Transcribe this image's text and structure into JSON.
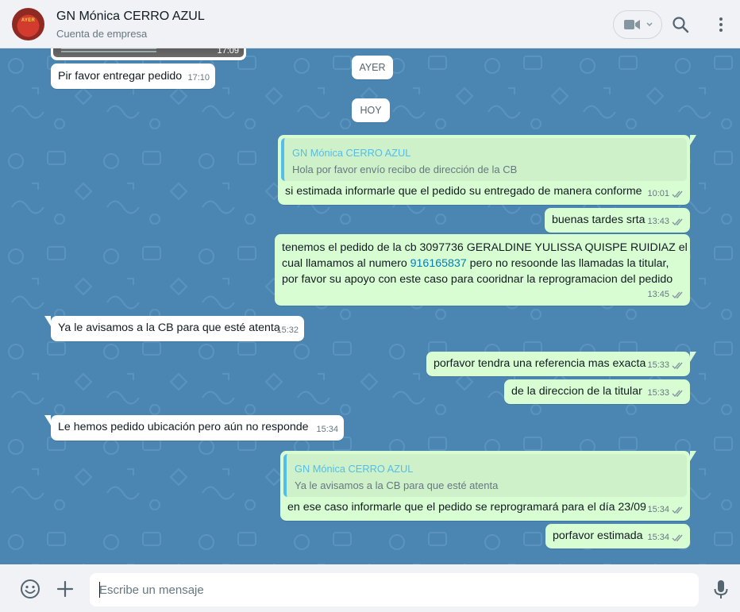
{
  "header": {
    "contact_name": "GN Mónica CERRO AZUL",
    "contact_subtitle": "Cuenta de empresa",
    "avatar_text": "AYER"
  },
  "chat": {
    "image_time": "17:09",
    "date_yesterday": "AYER",
    "date_today": "HOY",
    "messages": [
      {
        "dir": "in",
        "text": "Pir favor entregar pedido",
        "time": "17:10"
      },
      {
        "dir": "out",
        "quote_name": "GN Mónica CERRO AZUL",
        "quote_text": "Hola por favor envío recibo de dirección de la CB",
        "text": "si estimada informarle que el pedido su entregado de manera conforme",
        "time": "10:01"
      },
      {
        "dir": "out",
        "text": "buenas tardes srta",
        "time": "13:43"
      },
      {
        "dir": "out",
        "lines": [
          "tenemos el pedido de la cb 3097736 GERALDINE YULISSA QUISPE RUIDIAZ el",
          "cual llamamos al numero ",
          "916165837",
          " pero no resoonde las llamadas la titular,",
          "por favor su apoyo con este caso para cooridnar la reprogramacion del pedido"
        ],
        "time": "13:45"
      },
      {
        "dir": "in",
        "text": "Ya le avisamos a la CB para que esté atenta",
        "time": "15:32"
      },
      {
        "dir": "out",
        "text": "porfavor tendra una referencia mas exacta",
        "time": "15:33"
      },
      {
        "dir": "out",
        "text": "de la direccion de la titular",
        "time": "15:33"
      },
      {
        "dir": "in",
        "text": "Le hemos  pedido ubicación pero aún no responde",
        "time": "15:34"
      },
      {
        "dir": "out",
        "quote_name": "GN Mónica CERRO AZUL",
        "quote_text": "Ya le avisamos a la CB para que esté atenta",
        "text": "en ese caso informarle que el pedido se reprogramará para el día 23/09",
        "time": "15:34"
      },
      {
        "dir": "out",
        "text": "porfavor estimada",
        "time": "15:34"
      }
    ]
  },
  "composer": {
    "placeholder": "Escribe un mensaje"
  },
  "icons": {
    "video": "video-call-icon",
    "search": "search-icon",
    "menu": "menu-dots-icon",
    "emoji": "emoji-icon",
    "attach": "plus-icon",
    "mic": "microphone-icon",
    "read": "double-check-icon"
  },
  "colors": {
    "chat_bg": "#4b86b3",
    "outgoing_bubble": "#d9fdd3",
    "incoming_bubble": "#ffffff",
    "quote_accent": "#53bdeb",
    "link": "#027eb5"
  }
}
